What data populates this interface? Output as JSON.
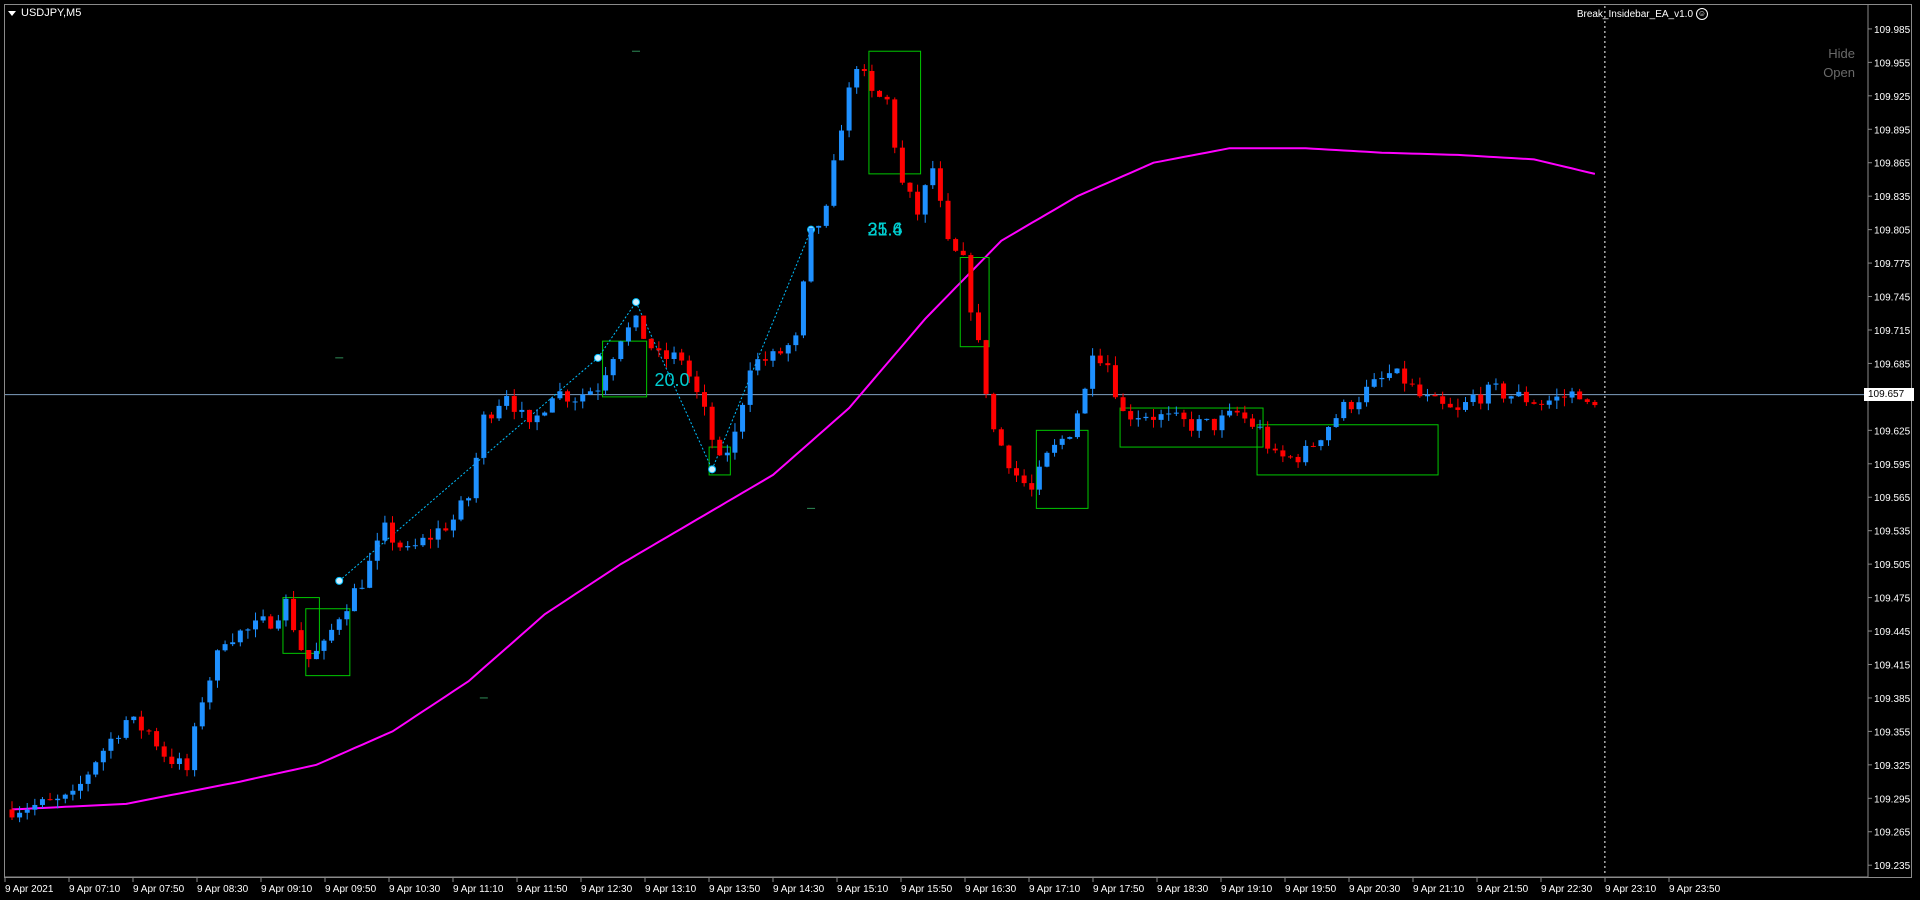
{
  "window": {
    "symbol_label": "USDJPY,M5",
    "ea_label": "Break_Insidebar_EA_v1.0",
    "ea_icon": "smiley-icon",
    "hide_label": "Hide",
    "open_label": "Open"
  },
  "current_price": "109.657",
  "colors": {
    "background": "#000000",
    "bull_candle": "#1e90ff",
    "bear_candle": "#ff0000",
    "ma_line": "#ff00ff",
    "box": "#00c800",
    "zigzag": "#00bfff",
    "bid_line": "#7f9fbf",
    "annotation": "#00ced1"
  },
  "chart_data": {
    "type": "candlestick",
    "symbol": "USDJPY",
    "timeframe": "M5",
    "y_ticks": [
      "109.985",
      "109.955",
      "109.925",
      "109.895",
      "109.865",
      "109.835",
      "109.805",
      "109.775",
      "109.745",
      "109.715",
      "109.685",
      "109.655",
      "109.625",
      "109.595",
      "109.565",
      "109.535",
      "109.505",
      "109.475",
      "109.445",
      "109.415",
      "109.385",
      "109.355",
      "109.325",
      "109.295",
      "109.265",
      "109.235"
    ],
    "ylim": [
      109.228,
      109.993
    ],
    "x_ticks": [
      "9 Apr 2021",
      "9 Apr 07:10",
      "9 Apr 07:50",
      "9 Apr 08:30",
      "9 Apr 09:10",
      "9 Apr 09:50",
      "9 Apr 10:30",
      "9 Apr 11:10",
      "9 Apr 11:50",
      "9 Apr 12:30",
      "9 Apr 13:10",
      "9 Apr 13:50",
      "9 Apr 14:30",
      "9 Apr 15:10",
      "9 Apr 15:50",
      "9 Apr 16:30",
      "9 Apr 17:10",
      "9 Apr 17:50",
      "9 Apr 18:30",
      "9 Apr 19:10",
      "9 Apr 19:50",
      "9 Apr 20:30",
      "9 Apr 21:10",
      "9 Apr 21:50",
      "9 Apr 22:30",
      "9 Apr 23:10",
      "9 Apr 23:50"
    ],
    "bid_price": 109.657,
    "anchors": [
      [
        0,
        109.285
      ],
      [
        6,
        109.29
      ],
      [
        9,
        109.295
      ],
      [
        12,
        109.33
      ],
      [
        16,
        109.365
      ],
      [
        19,
        109.355
      ],
      [
        21,
        109.335
      ],
      [
        24,
        109.32
      ],
      [
        26,
        109.385
      ],
      [
        29,
        109.44
      ],
      [
        32,
        109.445
      ],
      [
        35,
        109.455
      ],
      [
        37,
        109.47
      ],
      [
        39,
        109.43
      ],
      [
        40,
        109.42
      ],
      [
        42,
        109.43
      ],
      [
        44,
        109.46
      ],
      [
        47,
        109.49
      ],
      [
        50,
        109.535
      ],
      [
        53,
        109.515
      ],
      [
        56,
        109.53
      ],
      [
        59,
        109.545
      ],
      [
        61,
        109.565
      ],
      [
        63,
        109.635
      ],
      [
        66,
        109.66
      ],
      [
        69,
        109.625
      ],
      [
        72,
        109.66
      ],
      [
        75,
        109.655
      ],
      [
        78,
        109.665
      ],
      [
        81,
        109.71
      ],
      [
        83,
        109.72
      ],
      [
        86,
        109.69
      ],
      [
        89,
        109.69
      ],
      [
        92,
        109.64
      ],
      [
        94,
        109.595
      ],
      [
        96,
        109.62
      ],
      [
        98,
        109.685
      ],
      [
        101,
        109.69
      ],
      [
        104,
        109.705
      ],
      [
        106,
        109.8
      ],
      [
        108,
        109.82
      ],
      [
        110,
        109.9
      ],
      [
        112,
        109.955
      ],
      [
        114,
        109.925
      ],
      [
        116,
        109.92
      ],
      [
        118,
        109.845
      ],
      [
        120,
        109.82
      ],
      [
        122,
        109.86
      ],
      [
        124,
        109.79
      ],
      [
        126,
        109.775
      ],
      [
        128,
        109.7
      ],
      [
        130,
        109.625
      ],
      [
        133,
        109.585
      ],
      [
        135,
        109.57
      ],
      [
        137,
        109.6
      ],
      [
        140,
        109.625
      ],
      [
        142,
        109.66
      ],
      [
        143,
        109.7
      ],
      [
        145,
        109.685
      ],
      [
        147,
        109.64
      ],
      [
        150,
        109.64
      ],
      [
        153,
        109.635
      ],
      [
        156,
        109.63
      ],
      [
        159,
        109.63
      ],
      [
        162,
        109.64
      ],
      [
        165,
        109.625
      ],
      [
        167,
        109.6
      ],
      [
        169,
        109.6
      ],
      [
        171,
        109.605
      ],
      [
        174,
        109.63
      ],
      [
        176,
        109.645
      ],
      [
        179,
        109.66
      ],
      [
        182,
        109.675
      ],
      [
        184,
        109.67
      ],
      [
        186,
        109.655
      ],
      [
        189,
        109.645
      ],
      [
        191,
        109.64
      ],
      [
        193,
        109.655
      ],
      [
        196,
        109.66
      ],
      [
        199,
        109.655
      ],
      [
        202,
        109.65
      ],
      [
        205,
        109.655
      ],
      [
        207,
        109.66
      ],
      [
        208,
        109.645
      ]
    ],
    "series": [
      {
        "name": "",
        "type": "line",
        "anchors": [
          [
            0,
            109.285
          ],
          [
            15,
            109.29
          ],
          [
            30,
            109.31
          ],
          [
            40,
            109.325
          ],
          [
            50,
            109.355
          ],
          [
            60,
            109.4
          ],
          [
            70,
            109.46
          ],
          [
            80,
            109.505
          ],
          [
            90,
            109.545
          ],
          [
            100,
            109.585
          ],
          [
            110,
            109.645
          ],
          [
            120,
            109.725
          ],
          [
            130,
            109.795
          ],
          [
            140,
            109.835
          ],
          [
            150,
            109.865
          ],
          [
            160,
            109.878
          ],
          [
            170,
            109.878
          ],
          [
            180,
            109.874
          ],
          [
            190,
            109.872
          ],
          [
            200,
            109.868
          ],
          [
            208,
            109.855
          ]
        ]
      }
    ],
    "boxes": [
      {
        "x0": 36,
        "x1": 40,
        "high": 109.475,
        "low": 109.425
      },
      {
        "x0": 39,
        "x1": 44,
        "high": 109.465,
        "low": 109.405
      },
      {
        "x0": 78,
        "x1": 83,
        "high": 109.705,
        "low": 109.655
      },
      {
        "x0": 92,
        "x1": 94,
        "high": 109.61,
        "low": 109.585
      },
      {
        "x0": 113,
        "x1": 119,
        "high": 109.965,
        "low": 109.855
      },
      {
        "x0": 125,
        "x1": 128,
        "high": 109.78,
        "low": 109.7
      },
      {
        "x0": 135,
        "x1": 141,
        "high": 109.625,
        "low": 109.555
      },
      {
        "x0": 146,
        "x1": 164,
        "high": 109.645,
        "low": 109.61
      },
      {
        "x0": 164,
        "x1": 187,
        "high": 109.63,
        "low": 109.585
      }
    ],
    "zigzag": [
      [
        43,
        109.49
      ],
      [
        77,
        109.69
      ],
      [
        82,
        109.74
      ],
      [
        92,
        109.59
      ],
      [
        105,
        109.805
      ]
    ],
    "annotations": [
      {
        "text": "20.0",
        "x": 86,
        "y": 109.67
      },
      {
        "text": "25.6",
        "x": 114,
        "y": 109.805
      },
      {
        "text": "31.4",
        "x": 114,
        "y": 109.805
      }
    ],
    "dashes": [
      [
        43,
        109.69
      ],
      [
        82,
        109.965
      ],
      [
        62,
        109.385
      ],
      [
        105,
        109.555
      ]
    ],
    "dashed_vertical": 208,
    "n_bars": 209
  }
}
